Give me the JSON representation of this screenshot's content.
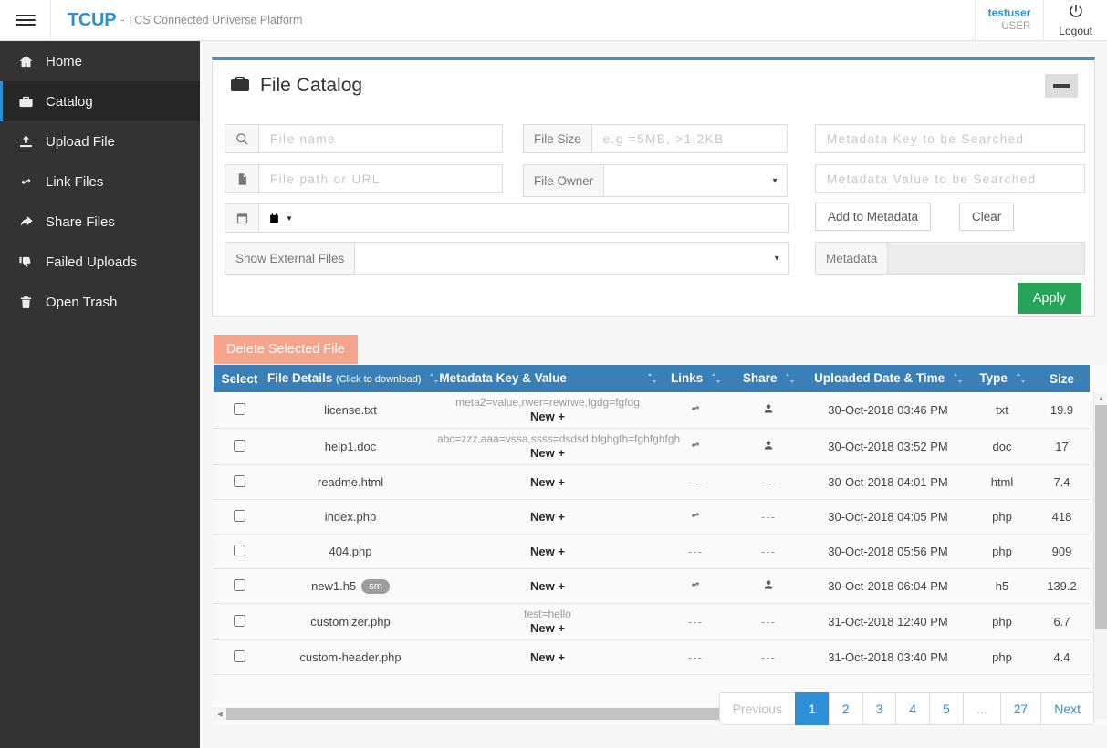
{
  "topbar": {
    "menu_icon": "hamburger-icon",
    "brand": "TCUP",
    "brand_subtitle": "- TCS Connected Universe Platform",
    "user_name": "testuser",
    "user_role": "USER",
    "logout_label": "Logout",
    "logout_icon": "power-icon"
  },
  "sidebar": {
    "items": [
      {
        "label": "Home",
        "icon": "home-icon",
        "active": false
      },
      {
        "label": "Catalog",
        "icon": "briefcase-icon",
        "active": true
      },
      {
        "label": "Upload File",
        "icon": "upload-icon",
        "active": false
      },
      {
        "label": "Link Files",
        "icon": "link-icon",
        "active": false
      },
      {
        "label": "Share Files",
        "icon": "share-arrow-icon",
        "active": false
      },
      {
        "label": "Failed Uploads",
        "icon": "thumbs-down-icon",
        "active": false
      },
      {
        "label": "Open Trash",
        "icon": "trash-icon",
        "active": false
      }
    ]
  },
  "panel": {
    "title": "File Catalog",
    "title_icon": "briefcase-icon",
    "minimize_icon": "minimize-icon",
    "accent_color": "#4c8fbd"
  },
  "search_form": {
    "file_name": {
      "placeholder": "File name",
      "value": "",
      "icon": "search-icon"
    },
    "file_path": {
      "placeholder": "File path or URL",
      "value": "",
      "icon": "file-icon"
    },
    "date_range": {
      "icon": "calendar-icon",
      "field_icon": "calendar-small-icon",
      "value": ""
    },
    "file_size": {
      "label": "File Size",
      "placeholder": "e.g =5MB, >1.2KB",
      "value": ""
    },
    "file_owner": {
      "label": "File Owner",
      "value": ""
    },
    "show_external_files": {
      "label": "Show External Files",
      "value": ""
    },
    "metadata_key": {
      "placeholder": "Metadata Key to be Searched",
      "value": ""
    },
    "metadata_value": {
      "placeholder": "Metadata Value to be Searched",
      "value": ""
    },
    "add_to_metadata_label": "Add to Metadata",
    "clear_label": "Clear",
    "metadata_label": "Metadata",
    "metadata_readonly_value": "",
    "apply_label": "Apply"
  },
  "table_toolbar": {
    "delete_label": "Delete Selected File"
  },
  "table": {
    "columns": [
      {
        "label": "Select",
        "sortable": false
      },
      {
        "label": "File Details",
        "sub": "(Click to download)",
        "sortable": true
      },
      {
        "label": "Metadata Key & Value",
        "sortable": true
      },
      {
        "label": "Links",
        "sortable": true
      },
      {
        "label": "Share",
        "sortable": true
      },
      {
        "label": "Uploaded Date & Time",
        "sortable": true
      },
      {
        "label": "Type",
        "sortable": true
      },
      {
        "label": "Size",
        "sortable": true
      }
    ],
    "new_label": "New +",
    "empty_cell": "---",
    "rows": [
      {
        "selected": false,
        "file_name": "license.txt",
        "badge": "",
        "metadata": "meta2=value,rwer=rewrwe,fgdg=fgfdg",
        "links": "link",
        "share": "user",
        "uploaded": "30-Oct-2018 03:46 PM",
        "type": "txt",
        "size": "19.9"
      },
      {
        "selected": false,
        "file_name": "help1.doc",
        "badge": "",
        "metadata": "abc=zzz,aaa=vssa,ssss=dsdsd,bfghgfh=fghfghfgh",
        "links": "link",
        "share": "user",
        "uploaded": "30-Oct-2018 03:52 PM",
        "type": "doc",
        "size": "17"
      },
      {
        "selected": false,
        "file_name": "readme.html",
        "badge": "",
        "metadata": "",
        "links": "---",
        "share": "---",
        "uploaded": "30-Oct-2018 04:01 PM",
        "type": "html",
        "size": "7.4"
      },
      {
        "selected": false,
        "file_name": "index.php",
        "badge": "",
        "metadata": "",
        "links": "link",
        "share": "---",
        "uploaded": "30-Oct-2018 04:05 PM",
        "type": "php",
        "size": "418"
      },
      {
        "selected": false,
        "file_name": "404.php",
        "badge": "",
        "metadata": "",
        "links": "---",
        "share": "---",
        "uploaded": "30-Oct-2018 05:56 PM",
        "type": "php",
        "size": "909"
      },
      {
        "selected": false,
        "file_name": "new1.h5",
        "badge": "sm",
        "metadata": "",
        "links": "link",
        "share": "user",
        "uploaded": "30-Oct-2018 06:04 PM",
        "type": "h5",
        "size": "139.2"
      },
      {
        "selected": false,
        "file_name": "customizer.php",
        "badge": "",
        "metadata": "test=hello",
        "links": "---",
        "share": "---",
        "uploaded": "31-Oct-2018 12:40 PM",
        "type": "php",
        "size": "6.7"
      },
      {
        "selected": false,
        "file_name": "custom-header.php",
        "badge": "",
        "metadata": "",
        "links": "---",
        "share": "---",
        "uploaded": "31-Oct-2018 03:40 PM",
        "type": "php",
        "size": "4.4"
      }
    ]
  },
  "pagination": {
    "previous_label": "Previous",
    "next_label": "Next",
    "ellipsis": "...",
    "pages": [
      "1",
      "2",
      "3",
      "4",
      "5"
    ],
    "last_page": "27",
    "current": "1"
  }
}
